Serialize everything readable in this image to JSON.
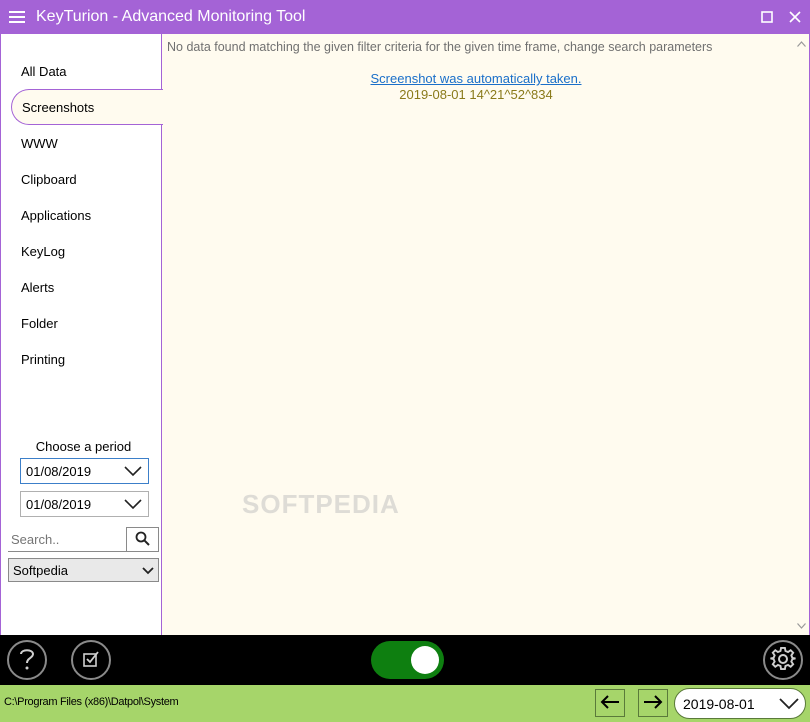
{
  "window": {
    "title": "KeyTurion - Advanced Monitoring Tool",
    "icons": {
      "menu": "hamburger-icon",
      "maximize": "maximize-icon",
      "close": "close-icon"
    }
  },
  "sidebar": {
    "items": [
      {
        "label": "All Data",
        "active": false
      },
      {
        "label": "Screenshots",
        "active": true
      },
      {
        "label": "WWW",
        "active": false
      },
      {
        "label": "Clipboard",
        "active": false
      },
      {
        "label": "Applications",
        "active": false
      },
      {
        "label": "KeyLog",
        "active": false
      },
      {
        "label": "Alerts",
        "active": false
      },
      {
        "label": "Folder",
        "active": false
      },
      {
        "label": "Printing",
        "active": false
      }
    ],
    "period_label": "Choose a period",
    "date_from": "01/08/2019",
    "date_to": "01/08/2019",
    "search_placeholder": "Search..",
    "user_selected": "Softpedia"
  },
  "main": {
    "empty_message": "No data found matching the given filter criteria for the given time frame, change search parameters",
    "entries": [
      {
        "link_text": "Screenshot was automatically taken.",
        "timestamp": "2019-08-01 14^21^52^834"
      }
    ],
    "watermark": "SOFTPEDIA"
  },
  "toolbar": {
    "help_icon": "question-mark-icon",
    "check_icon": "checkbox-icon",
    "monitoring_on": true,
    "settings_icon": "gear-icon"
  },
  "statusbar": {
    "path": "C:\\Program Files (x86)\\Datpol\\System",
    "current_date": "2019-08-01"
  },
  "colors": {
    "accent": "#a463d6",
    "content_bg": "#fffbef",
    "toolbar_bg": "#000000",
    "status_bg": "#a6d56a",
    "toggle_on": "#0e7f10",
    "link": "#1a6fc9",
    "timestamp": "#8a7a1a"
  }
}
